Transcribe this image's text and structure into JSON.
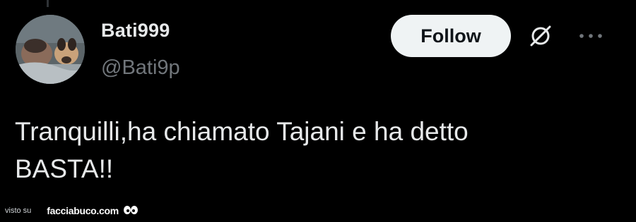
{
  "profile": {
    "display_name": "Bati999",
    "handle": "@Bati9p"
  },
  "actions": {
    "follow_label": "Follow",
    "grok_icon": "grok-icon",
    "more_icon": "more-horizontal-icon"
  },
  "tweet": {
    "line1": "Tranquilli,ha chiamato Tajani e ha detto",
    "line2": "BASTA!!"
  },
  "watermark": {
    "prefix": "visto su",
    "site": "facciabuco.com"
  },
  "colors": {
    "background": "#000000",
    "text_primary": "#e7e9ea",
    "text_secondary": "#71767b",
    "follow_bg": "#eff3f4"
  }
}
